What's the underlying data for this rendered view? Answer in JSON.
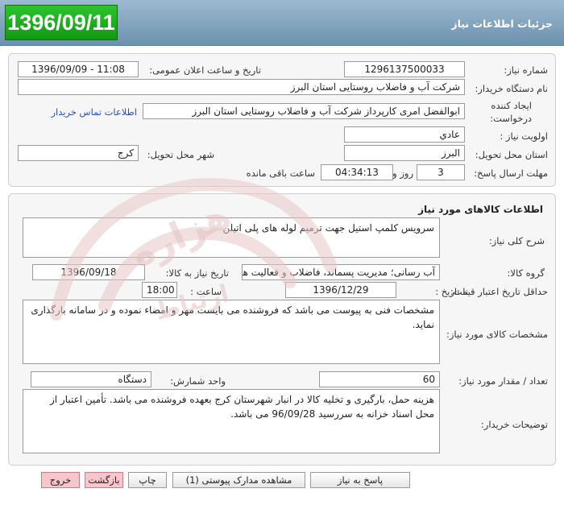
{
  "header": {
    "date": "1396/09/11",
    "title": "جزئیات اطلاعات نیاز"
  },
  "info": {
    "need_number_label": "شماره نیاز:",
    "need_number": "1296137500033",
    "announce_label": "تاریخ و ساعت اعلان عمومی:",
    "announce_value": "1396/09/09 - 11:08",
    "buyer_label": "نام دستگاه خریدار:",
    "buyer_value": "شرکت آب و فاضلاب روستایی استان البرز",
    "creator_label_1": "ایجاد کننده",
    "creator_label_2": "درخواست:",
    "creator_value": "ابوالفضل امری کارپرداز شرکت آب و فاضلاب روستایی استان البرز",
    "contact_link": "اطلاعات تماس خریدار",
    "priority_label": "اولویت نیاز :",
    "priority_value": "عادي",
    "province_label": "استان محل تحویل:",
    "province_value": "البرز",
    "city_label": "شهر محل تحویل:",
    "city_value": "کرج",
    "deadline_label": "مهلت ارسال پاسخ:",
    "days_value": "3",
    "days_label": "روز و",
    "time_value": "04:34:13",
    "remaining_label": "ساعت باقی مانده"
  },
  "goods": {
    "section_title": "اطلاعات کالاهای مورد نیاز",
    "general_desc_label": "شرح کلی نیاز:",
    "general_desc_value": "سرویس کلمپ استیل جهت ترمیم لوله های پلی اتیلن",
    "group_label": "گروه کالا:",
    "group_value": "آب رسانی؛ مدیریت پسماند، فاضلاب و فعالیت های",
    "need_date_label": "تاریخ نیاز به کالا:",
    "need_date_value": "1396/09/18",
    "min_price_label": "حداقل تاریخ اعتبار قیمت:",
    "until_label": "تا تاریخ :",
    "until_value": "1396/12/29",
    "hour_label": "ساعت :",
    "hour_value": "18:00",
    "specs_label": "مشخصات کالای مورد نیاز:",
    "specs_value": "مشخصات فنی به پیوست می باشد که فروشنده می بایست مهر و امضاء نموده و در سامانه بارگذاری نماید.",
    "qty_label": "تعداد / مقدار مورد نیاز:",
    "qty_value": "60",
    "unit_label": "واحد شمارش:",
    "unit_value": "دستگاه",
    "buyer_notes_label": "توضیحات خریدار:",
    "buyer_notes_value": "هزینه حمل، بارگیری و تخلیه کالا در انبار شهرستان کرج بعهده فروشنده می باشد. تأمین اعتبار از محل اسناد خزانه به سررسید 96/09/28 می باشد."
  },
  "buttons": {
    "reply": "پاسخ به نیاز",
    "attachments": "مشاهده مدارک پیوستی (1)",
    "print": "چاپ",
    "back": "بازگشت",
    "exit": "خروج"
  },
  "colors": {
    "header_bg": "#7fa1bb",
    "date_banner": "#1fae1f",
    "link": "#2b4fbf",
    "pink_button": "#f6c6cc"
  }
}
